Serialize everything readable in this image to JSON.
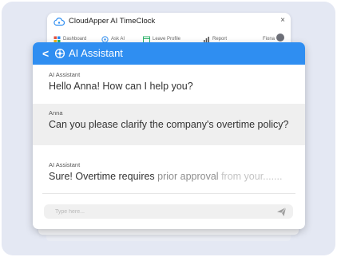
{
  "app": {
    "title": "CloudApper AI TimeClock",
    "close_glyph": "×",
    "nav": [
      {
        "label": "Dashboard",
        "icon": "dashboard-icon"
      },
      {
        "label": "Ask AI",
        "icon": "ai-icon"
      },
      {
        "label": "Leave Profile",
        "icon": "leave-icon"
      },
      {
        "label": "Report",
        "icon": "report-icon"
      }
    ],
    "user_name": "Fiona"
  },
  "chat": {
    "back_glyph": "<",
    "title": "AI Assistant",
    "messages": [
      {
        "sender": "AI Assistant",
        "text": "Hello Anna! How can I help you?"
      },
      {
        "sender": "Anna",
        "text": "Can you please clarify the company's overtime policy?"
      },
      {
        "sender": "AI Assistant",
        "text_parts": [
          "Sure! Overtime requires",
          " prior approval",
          " from your......."
        ]
      }
    ],
    "input_placeholder": "Type here..."
  },
  "colors": {
    "accent": "#2f8ef1",
    "backdrop": "#e4e8f3",
    "selected_message_bg": "#efefef"
  }
}
